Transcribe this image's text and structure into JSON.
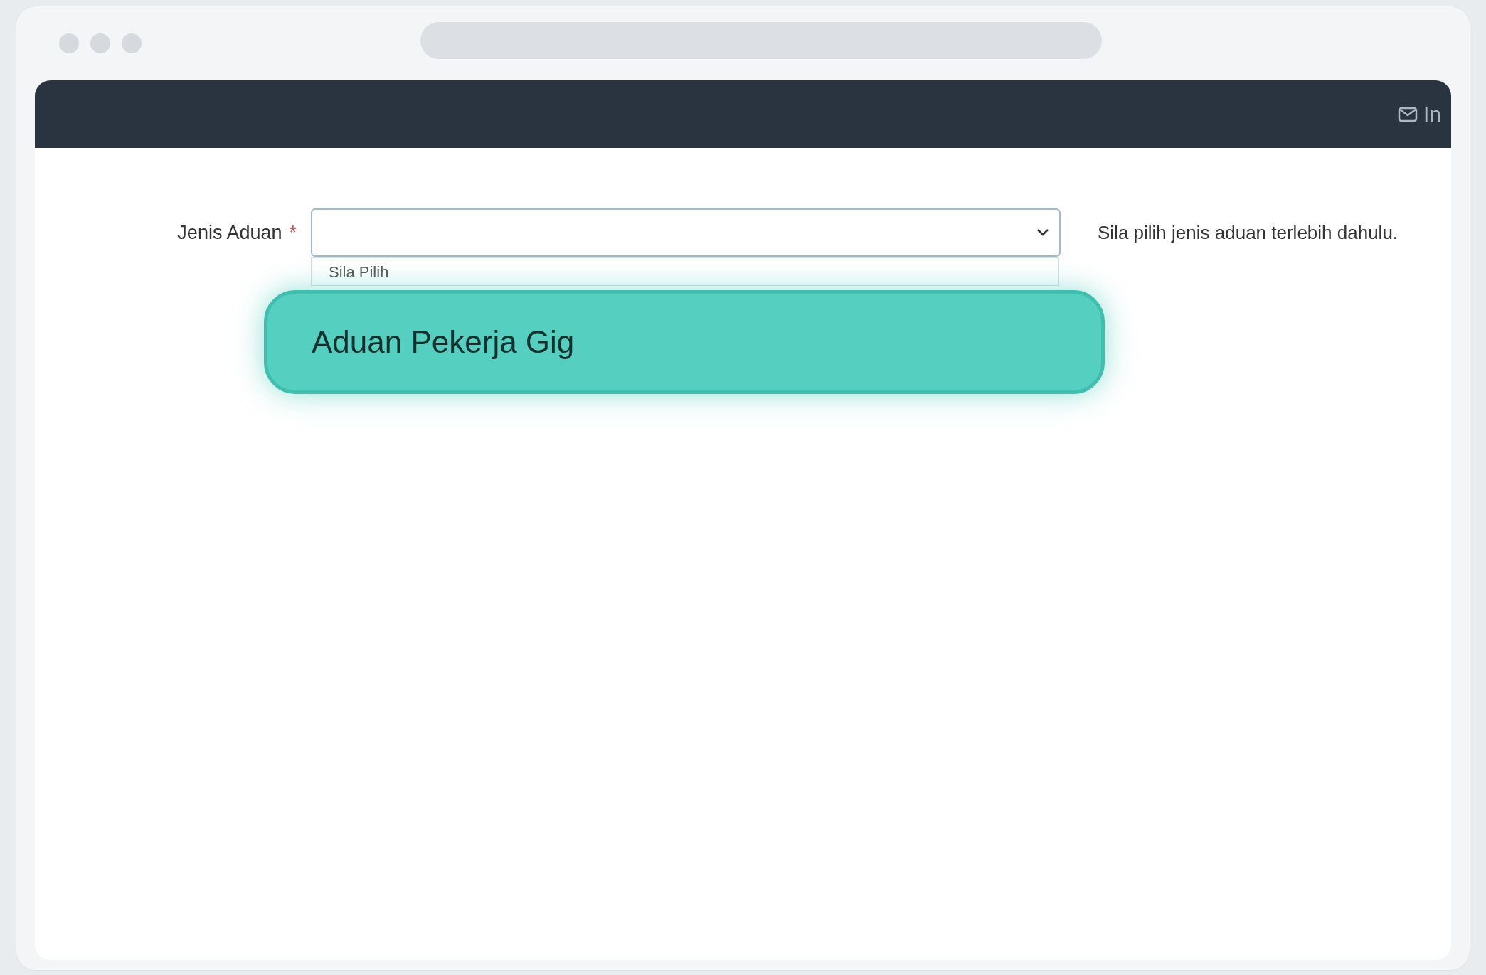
{
  "header": {
    "link": {
      "label": "In"
    }
  },
  "form": {
    "field": {
      "label": "Jenis Aduan",
      "required_mark": "*",
      "helper": "Sila pilih jenis aduan terlebih dahulu.",
      "expanded": true,
      "options": [
        {
          "label": "Sila Pilih",
          "selected": false
        },
        {
          "label": "Aduan Pekerja Gig",
          "selected": true
        }
      ]
    }
  }
}
